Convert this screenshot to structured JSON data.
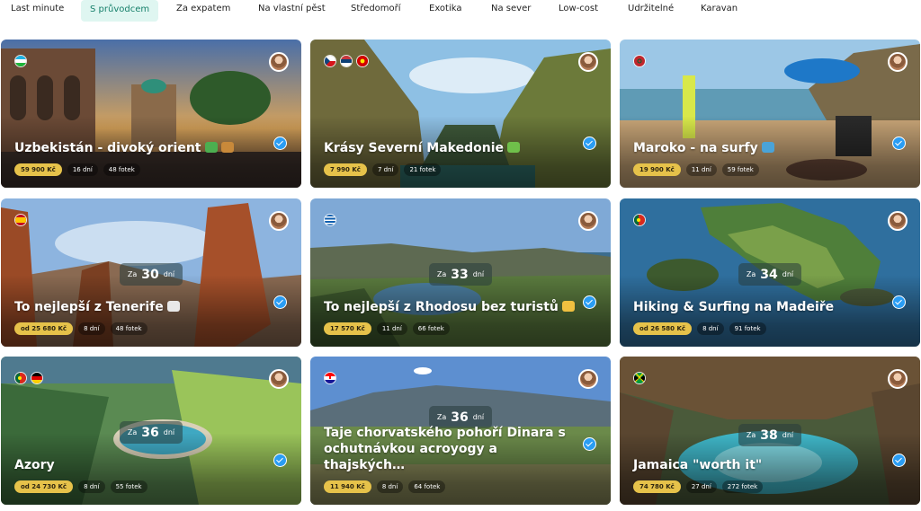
{
  "tabs": [
    {
      "label": "Last minute",
      "active": false
    },
    {
      "label": "S průvodcem",
      "active": true
    },
    {
      "label": "Za expatem",
      "active": false
    },
    {
      "label": "Na vlastní pěst",
      "active": false
    },
    {
      "label": "Středomoří",
      "active": false
    },
    {
      "label": "Exotika",
      "active": false
    },
    {
      "label": "Na sever",
      "active": false
    },
    {
      "label": "Low-cost",
      "active": false
    },
    {
      "label": "Udržitelné",
      "active": false
    },
    {
      "label": "Karavan",
      "active": false
    }
  ],
  "cards": [
    {
      "title": "Uzbekistán - divoký orient",
      "price": "59 900 Kč",
      "days": "16 dní",
      "photos": "48 fotek",
      "flags": [
        "uzbekistan"
      ],
      "countdown": null
    },
    {
      "title": "Krásy Severní Makedonie",
      "price": "7 990 Kč",
      "days": "7 dní",
      "photos": "21 fotek",
      "flags": [
        "czechia",
        "serbia",
        "north-macedonia"
      ],
      "countdown": null
    },
    {
      "title": "Maroko - na surfy",
      "price": "19 900 Kč",
      "days": "11 dní",
      "photos": "59 fotek",
      "flags": [
        "morocco"
      ],
      "countdown": null
    },
    {
      "title": "To nejlepší z Tenerife",
      "price": "od 25 680 Kč",
      "days": "8 dní",
      "photos": "48 fotek",
      "flags": [
        "spain"
      ],
      "countdown": {
        "pre": "Za",
        "num": "30",
        "post": "dní"
      }
    },
    {
      "title": "To nejlepší z Rhodosu bez turistů",
      "price": "17 570 Kč",
      "days": "11 dní",
      "photos": "66 fotek",
      "flags": [
        "greece"
      ],
      "countdown": {
        "pre": "Za",
        "num": "33",
        "post": "dní"
      }
    },
    {
      "title": "Hiking & Surfing na Madeiře",
      "price": "od 26 580 Kč",
      "days": "8 dní",
      "photos": "91 fotek",
      "flags": [
        "portugal"
      ],
      "countdown": {
        "pre": "Za",
        "num": "34",
        "post": "dní"
      }
    },
    {
      "title": "Azory",
      "price": "od 24 730 Kč",
      "days": "8 dní",
      "photos": "55 fotek",
      "flags": [
        "portugal",
        "germany"
      ],
      "countdown": {
        "pre": "Za",
        "num": "36",
        "post": "dní"
      }
    },
    {
      "title": "Taje chorvatského pohoří Dinara s ochutnávkou acroyogy a thajských…",
      "price": "11 940 Kč",
      "days": "8 dní",
      "photos": "64 fotek",
      "flags": [
        "croatia"
      ],
      "countdown": {
        "pre": "Za",
        "num": "36",
        "post": "dní"
      }
    },
    {
      "title": "Jamaica \"worth it\"",
      "price": "74 780 Kč",
      "days": "27 dní",
      "photos": "272 fotek",
      "flags": [
        "jamaica"
      ],
      "countdown": {
        "pre": "Za",
        "num": "38",
        "post": "dní"
      }
    }
  ],
  "icons": {
    "verified": "verified-check-icon",
    "avatar": "guide-avatar"
  }
}
